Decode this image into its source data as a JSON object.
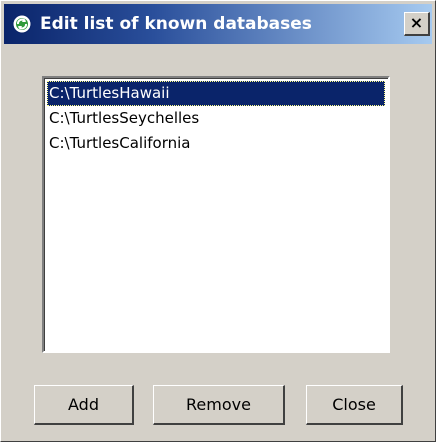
{
  "window": {
    "title": "Edit list of known databases",
    "close_glyph": "×",
    "icon": "refresh-circle-icon",
    "colors": {
      "titlebar_start": "#0a246a",
      "titlebar_end": "#a6caf0",
      "face": "#d4d0c8",
      "selection": "#0a246a"
    }
  },
  "database_list": {
    "items": [
      {
        "label": "C:\\TurtlesHawaii",
        "selected": true
      },
      {
        "label": "C:\\TurtlesSeychelles",
        "selected": false
      },
      {
        "label": "C:\\TurtlesCalifornia",
        "selected": false
      }
    ]
  },
  "buttons": {
    "add_label": "Add",
    "remove_label": "Remove",
    "close_label": "Close"
  }
}
